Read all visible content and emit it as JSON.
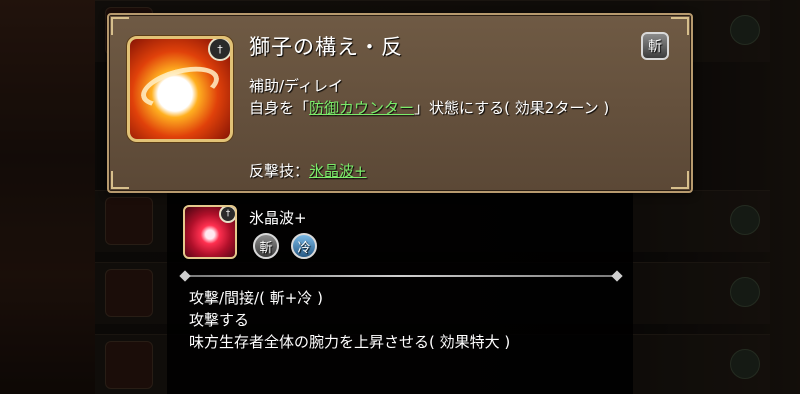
{
  "skill": {
    "name": "獅子の構え・反",
    "attribute_badge": "斬",
    "type_line": "補助/ディレイ",
    "desc_prefix": "自身を「",
    "desc_link": "防御カウンター",
    "desc_suffix": "」状態にする( 効果2ターン )",
    "counter_label": "反撃技：",
    "counter_skill": "氷晶波+",
    "icon": "lion-stance-icon"
  },
  "tooltip": {
    "name": "氷晶波+",
    "attr_slash": "斬",
    "attr_ice": "冷",
    "line1": "攻撃/間接/( 斬+冷 )",
    "line2": "攻撃する",
    "line3": "味方生存者全体の腕力を上昇させる( 効果特大 )",
    "icon": "ice-crystal-wave-icon"
  },
  "colors": {
    "panel": "#6f5a44",
    "panel_border": "#b79a6e",
    "link_green": "#7cec6a"
  }
}
